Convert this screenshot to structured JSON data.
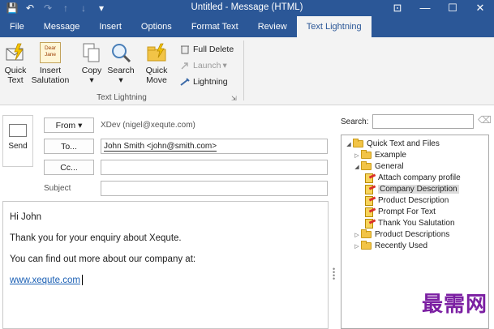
{
  "window": {
    "title": "Untitled - Message (HTML)",
    "controls": {
      "minimize": "—",
      "restore": "☐",
      "close": "✕",
      "ribbon_display": "⊡"
    }
  },
  "qat": {
    "save": "💾",
    "undo": "↶",
    "redo": "↷",
    "up": "↑",
    "down": "↓",
    "more": "▾"
  },
  "tabs": [
    "File",
    "Message",
    "Insert",
    "Options",
    "Format Text",
    "Review",
    "Text Lightning"
  ],
  "active_tab": "Text Lightning",
  "ribbon": {
    "quick_text": "Quick\nText",
    "insert_salutation": "Insert\nSalutation",
    "copy": "Copy",
    "search": "Search",
    "quick_move": "Quick\nMove",
    "full_delete": "Full Delete",
    "launch": "Launch",
    "lightning": "Lightning",
    "group_label": "Text Lightning",
    "dropdown_arrow": "▾",
    "launcher_glyph": "⇲",
    "salutation_icon_text": "Dear\nJane"
  },
  "compose": {
    "send": "Send",
    "from_button": "From ▾",
    "from_value": "XDev (nigel@xequte.com)",
    "to_button": "To...",
    "to_value": "John Smith <john@smith.com>",
    "cc_button": "Cc...",
    "cc_value": "",
    "subject_label": "Subject",
    "subject_value": ""
  },
  "body": {
    "greeting": "Hi John",
    "line1": "Thank you for your enquiry about Xequte.",
    "line2": "You can find out more about our company at:",
    "link": "www.xequte.com"
  },
  "pane": {
    "search_label": "Search:",
    "search_value": "",
    "tree": [
      {
        "label": "Quick Text and Files",
        "type": "folder",
        "level": 0,
        "expanded": true
      },
      {
        "label": "Example",
        "type": "folder",
        "level": 1,
        "expanded": false
      },
      {
        "label": "General",
        "type": "folder",
        "level": 1,
        "expanded": true
      },
      {
        "label": "Attach company profile",
        "type": "item",
        "level": 2
      },
      {
        "label": "Company Description",
        "type": "item",
        "level": 2,
        "selected": true
      },
      {
        "label": "Product Description",
        "type": "item",
        "level": 2
      },
      {
        "label": "Prompt For Text",
        "type": "item",
        "level": 2
      },
      {
        "label": "Thank You Salutation",
        "type": "item",
        "level": 2
      },
      {
        "label": "Product Descriptions",
        "type": "folder",
        "level": 1,
        "expanded": false
      },
      {
        "label": "Recently Used",
        "type": "folder",
        "level": 1,
        "expanded": false
      }
    ]
  },
  "watermark": "最需网",
  "colors": {
    "titlebar": "#2b5797",
    "ribbon_bg": "#f3f3f3",
    "link": "#1a5fb4",
    "watermark": "#7b1fa2"
  }
}
